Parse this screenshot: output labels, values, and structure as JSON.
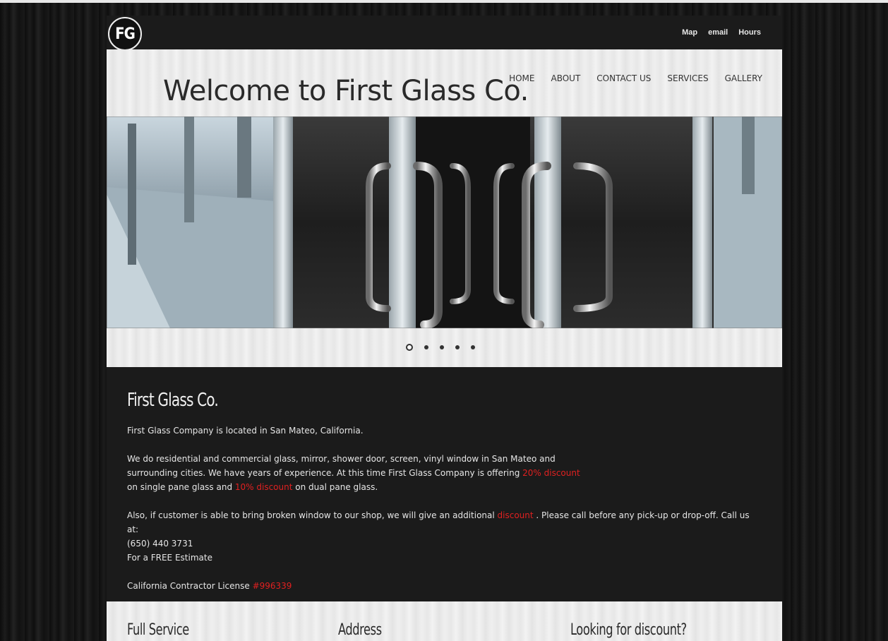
{
  "brand": {
    "logo_text": "FG"
  },
  "top_links": [
    "Map",
    "email",
    "Hours"
  ],
  "header": {
    "title": "Welcome to First Glass Co."
  },
  "nav": [
    "HOME",
    "ABOUT",
    "CONTACT US",
    "SERVICES",
    "GALLERY"
  ],
  "slider": {
    "dot_count": 5,
    "active_index": 0
  },
  "main": {
    "heading": "First Glass Co.",
    "p1": "First Glass Company is located in San Mateo, California.",
    "p2_a": "We do residential and commercial glass, mirror, shower door, screen, vinyl window in San Mateo and",
    "p2_b": "surrounding cities. We have years of experience. At this time First Glass Company is offering ",
    "p2_discount1": "20% discount",
    "p2_c": "on single pane glass and ",
    "p2_discount2": "10% discount",
    "p2_d": " on dual pane glass.",
    "p3_a": "Also, if customer is able to bring broken window to our shop, we will give an additional ",
    "p3_discount": "discount",
    "p3_b": " . Please call before any pick-up or drop-off. Call us at:",
    "phone": "(650) 440 3731",
    "estimate": "For a FREE Estimate",
    "license_label": "California Contractor License ",
    "license_number": "#996339"
  },
  "footer": {
    "col1": "Full Service",
    "col2": "Address",
    "col3": "Looking for discount?"
  },
  "colors": {
    "accent_red": "#e02020",
    "dark_bg": "#1b1b1b",
    "light_panel": "#ebebeb"
  }
}
